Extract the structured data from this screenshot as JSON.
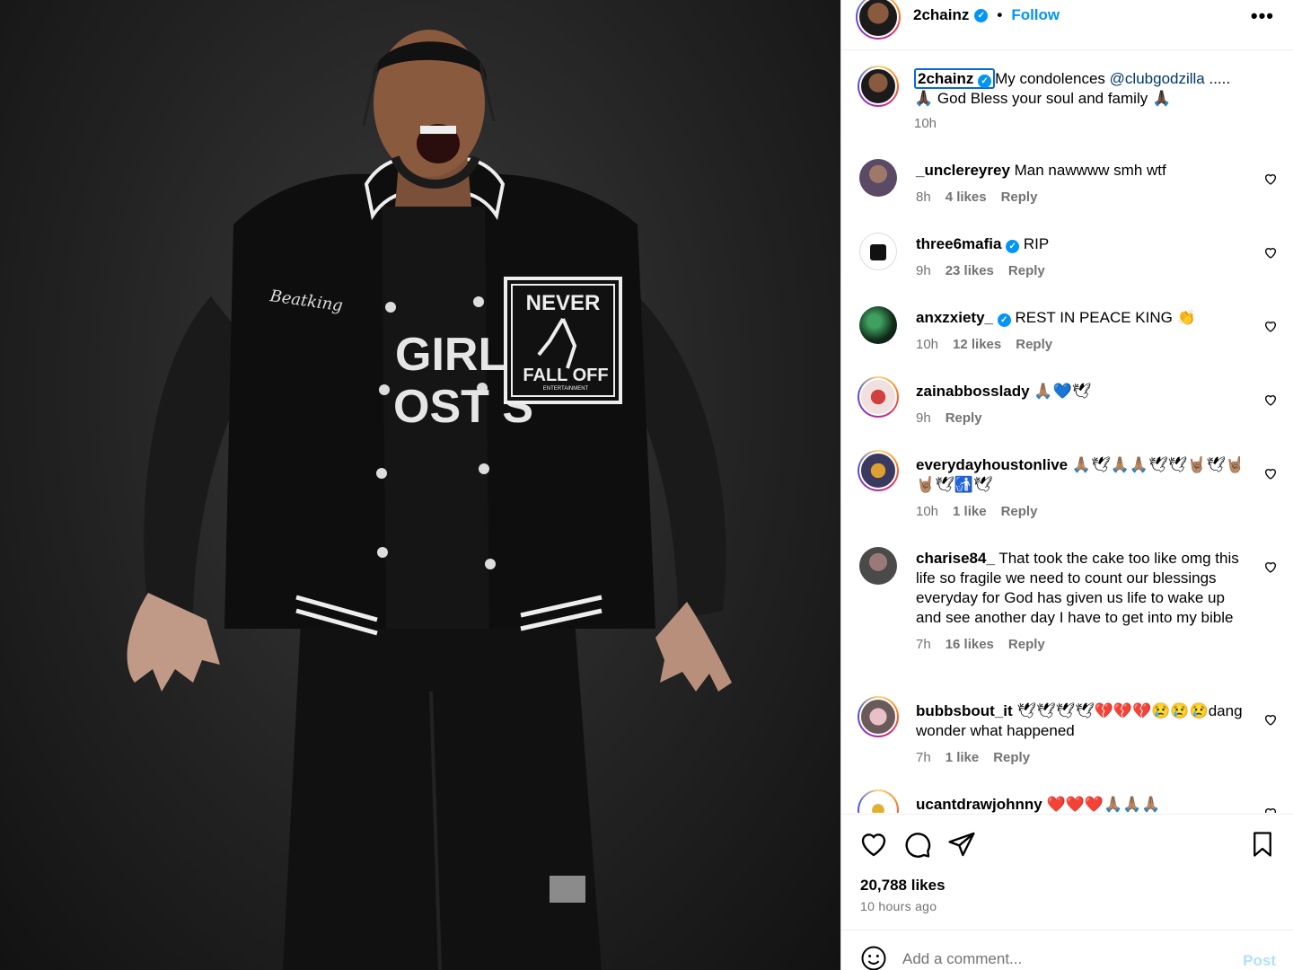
{
  "header": {
    "username": "2chainz",
    "separator": "•",
    "follow_label": "Follow",
    "more_label": "•••"
  },
  "media": {
    "jacket_patch_top": "NEVER",
    "jacket_patch_bottom": "FALL OFF",
    "jacket_patch_small": "ENTERTAINMENT",
    "jacket_script": "Beatking",
    "shirt_text_1": "GIRLS",
    "shirt_text_2": "OST S"
  },
  "caption": {
    "username": "2chainz",
    "text_before": "My condolences ",
    "mention": "@clubgodzilla",
    "text_after": " .....\n🙏🏿 God Bless your soul and family 🙏🏿",
    "time": "10h"
  },
  "comments": [
    {
      "username": "_unclereyrey",
      "text": "Man nawwww smh wtf",
      "time": "8h",
      "likes": "4 likes",
      "reply": "Reply",
      "verified": false
    },
    {
      "username": "three6mafia",
      "text": "RIP",
      "time": "9h",
      "likes": "23 likes",
      "reply": "Reply",
      "verified": true
    },
    {
      "username": "anxzxiety_",
      "text": "REST IN PEACE KING 👏",
      "time": "10h",
      "likes": "12 likes",
      "reply": "Reply",
      "verified": true
    },
    {
      "username": "zainabbosslady",
      "text": "🙏🏽💙🕊",
      "time": "9h",
      "likes": "",
      "reply": "Reply",
      "verified": false
    },
    {
      "username": "everydayhoustonlive",
      "text": "🙏🏽🕊🙏🏽🙏🏽🕊🕊🤘🏽🕊🤘🏽🤘🏽🕊🚮🕊",
      "time": "10h",
      "likes": "1 like",
      "reply": "Reply",
      "verified": false
    },
    {
      "username": "charise84_",
      "text": "That took the cake too like omg this life so fragile we need to count our blessings everyday for God has given us life to wake up and see another day I have to get into my bible",
      "time": "7h",
      "likes": "16 likes",
      "reply": "Reply",
      "verified": false
    },
    {
      "username": "bubbsbout_it",
      "text": "🕊🕊🕊🕊💔💔💔😢😢😢dang wonder what happened",
      "time": "7h",
      "likes": "1 like",
      "reply": "Reply",
      "verified": false
    },
    {
      "username": "ucantdrawjohnny",
      "text": "❤️❤️❤️🙏🏽🙏🏽🙏🏽",
      "time": "",
      "likes": "",
      "reply": "",
      "verified": false
    }
  ],
  "actions": {
    "like_count": "20,788 likes",
    "posted": "10 hours ago"
  },
  "composer": {
    "placeholder": "Add a comment...",
    "post_label": "Post"
  },
  "colors": {
    "link": "#0095f6",
    "mention": "#00376b",
    "muted": "#737373"
  },
  "icons": [
    "heart-icon",
    "comment-icon",
    "share-icon",
    "bookmark-icon",
    "emoji-icon",
    "verified-icon",
    "more-icon"
  ]
}
